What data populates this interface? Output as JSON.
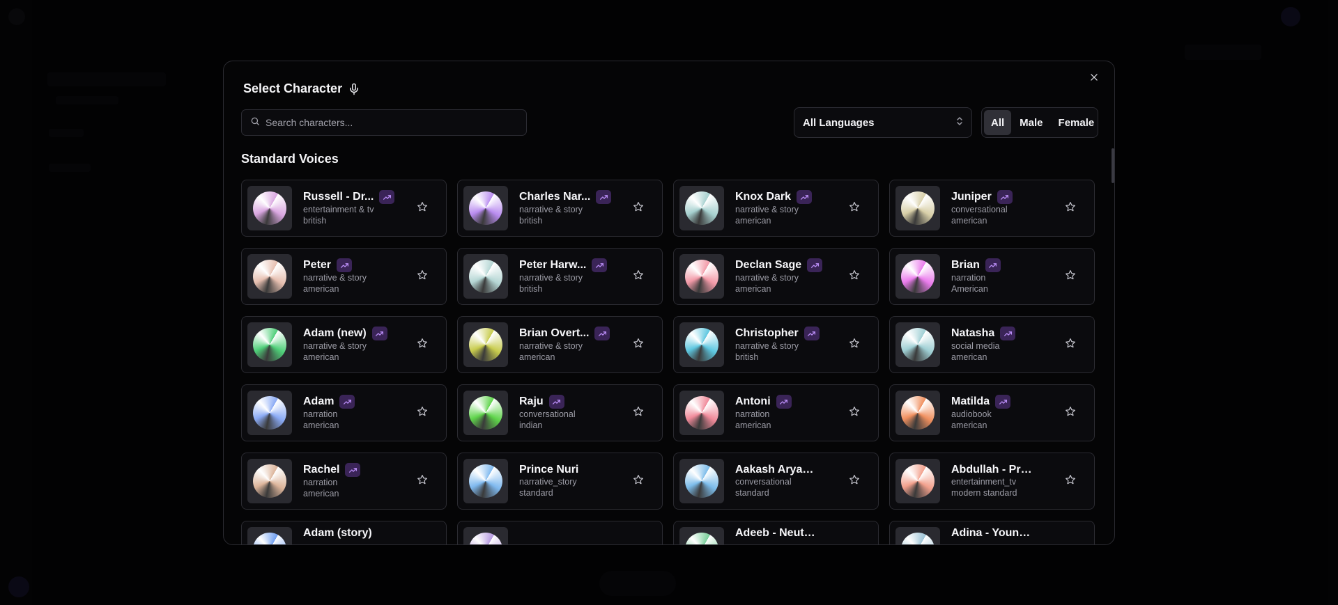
{
  "modal": {
    "title": "Select Character",
    "search_placeholder": "Search characters...",
    "language_select": "All Languages",
    "gender_filters": [
      "All",
      "Male",
      "Female"
    ],
    "active_gender": "All",
    "section_title": "Standard Voices"
  },
  "characters": [
    {
      "name": "Russell - Dr...",
      "category": "entertainment & tv",
      "accent": "british",
      "trending": true,
      "color": "#d9a6e0"
    },
    {
      "name": "Charles Nar...",
      "category": "narrative & story",
      "accent": "british",
      "trending": true,
      "color": "#b98cf0"
    },
    {
      "name": "Knox Dark",
      "category": "narrative & story",
      "accent": "american",
      "trending": true,
      "color": "#a6d0cf"
    },
    {
      "name": "Juniper",
      "category": "conversational",
      "accent": "american",
      "trending": true,
      "color": "#d8cfa8"
    },
    {
      "name": "Peter",
      "category": "narrative & story",
      "accent": "american",
      "trending": true,
      "color": "#e6bfb0"
    },
    {
      "name": "Peter Harw...",
      "category": "narrative & story",
      "accent": "british",
      "trending": true,
      "color": "#b5d6d4"
    },
    {
      "name": "Declan Sage",
      "category": "narrative & story",
      "accent": "american",
      "trending": true,
      "color": "#f29aa8"
    },
    {
      "name": "Brian",
      "category": "narration",
      "accent": "American",
      "trending": true,
      "color": "#ea7cec"
    },
    {
      "name": "Adam (new)",
      "category": "narrative & story",
      "accent": "american",
      "trending": true,
      "color": "#4fcf79"
    },
    {
      "name": "Brian Overt...",
      "category": "narrative & story",
      "accent": "american",
      "trending": true,
      "color": "#c8cc4e"
    },
    {
      "name": "Christopher",
      "category": "narrative & story",
      "accent": "british",
      "trending": true,
      "color": "#5ec7e0"
    },
    {
      "name": "Natasha",
      "category": "social media",
      "accent": "american",
      "trending": true,
      "color": "#9fcfd4"
    },
    {
      "name": "Adam",
      "category": "narration",
      "accent": "american",
      "trending": true,
      "color": "#8aaaf5"
    },
    {
      "name": "Raju",
      "category": "conversational",
      "accent": "indian",
      "trending": true,
      "color": "#5fd44b"
    },
    {
      "name": "Antoni",
      "category": "narration",
      "accent": "american",
      "trending": true,
      "color": "#f08a9a"
    },
    {
      "name": "Matilda",
      "category": "audiobook",
      "accent": "american",
      "trending": true,
      "color": "#f0905f"
    },
    {
      "name": "Rachel",
      "category": "narration",
      "accent": "american",
      "trending": true,
      "color": "#dcb49a"
    },
    {
      "name": "Prince Nuri",
      "category": "narrative_story",
      "accent": "standard",
      "trending": false,
      "color": "#7fb9ef"
    },
    {
      "name": "Aakash Aryan - ...",
      "category": "conversational",
      "accent": "standard",
      "trending": false,
      "color": "#7cbcea"
    },
    {
      "name": "Abdullah - Prof...",
      "category": "entertainment_tv",
      "accent": "modern standard",
      "trending": false,
      "color": "#f2a08c"
    },
    {
      "name": "Adam (story)",
      "category": "",
      "accent": "",
      "trending": false,
      "color": "#6f9ff2"
    },
    {
      "name": "",
      "category": "",
      "accent": "",
      "trending": false,
      "color": "#b69ae0"
    },
    {
      "name": "Adeeb - Neutral...",
      "category": "",
      "accent": "",
      "trending": false,
      "color": "#79cf9a"
    },
    {
      "name": "Adina - Young, ...",
      "category": "",
      "accent": "",
      "trending": false,
      "color": "#9cc3d6"
    }
  ]
}
